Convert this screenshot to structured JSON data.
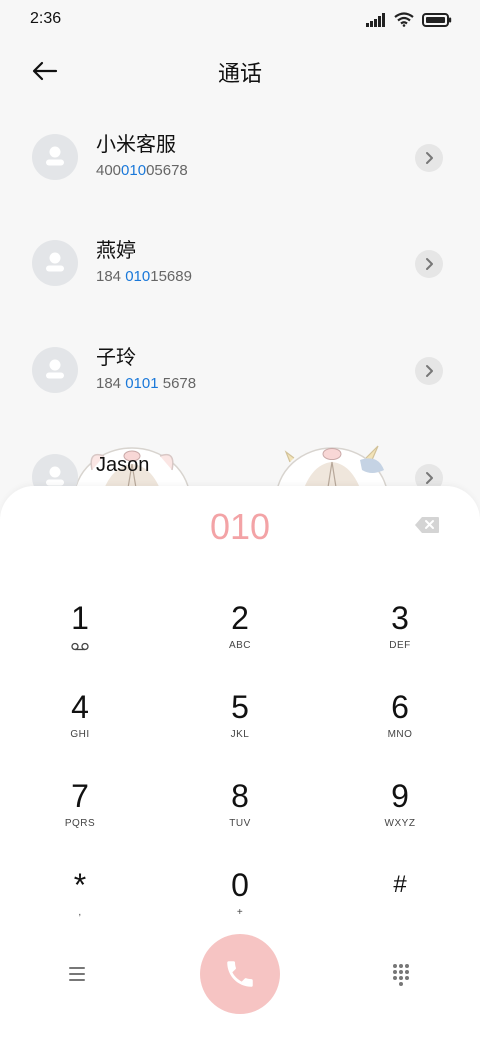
{
  "status_bar": {
    "time": "2:36"
  },
  "header": {
    "title": "通话"
  },
  "contacts": [
    {
      "name": "小米客服",
      "number_pre": "400",
      "number_hl": "010",
      "number_post": "05678"
    },
    {
      "name": "燕婷",
      "number_pre": "184 ",
      "number_hl": "010",
      "number_post": "15689"
    },
    {
      "name": "子玲",
      "number_pre": "184 ",
      "number_hl": "0101",
      "number_post": " 5678"
    },
    {
      "name": "Jason",
      "number_pre": "",
      "number_hl": "",
      "number_post": ""
    }
  ],
  "dialpad": {
    "entered_number": "010",
    "keys": [
      {
        "digit": "1",
        "letters": ""
      },
      {
        "digit": "2",
        "letters": "ABC"
      },
      {
        "digit": "3",
        "letters": "DEF"
      },
      {
        "digit": "4",
        "letters": "GHI"
      },
      {
        "digit": "5",
        "letters": "JKL"
      },
      {
        "digit": "6",
        "letters": "MNO"
      },
      {
        "digit": "7",
        "letters": "PQRS"
      },
      {
        "digit": "8",
        "letters": "TUV"
      },
      {
        "digit": "9",
        "letters": "WXYZ"
      },
      {
        "digit": "*",
        "letters": ","
      },
      {
        "digit": "0",
        "letters": "+"
      },
      {
        "digit": "#",
        "letters": ""
      }
    ]
  },
  "icons": {
    "back": "arrow-left-icon",
    "chevron": "chevron-right-icon",
    "backspace": "backspace-icon",
    "voicemail": "voicemail-icon",
    "menu": "menu-icon",
    "call": "phone-icon",
    "keypad": "dialpad-icon"
  },
  "colors": {
    "accent_highlight": "#1a78d9",
    "dialed_number": "#f3a3a6",
    "call_button": "#f6c4c3"
  }
}
